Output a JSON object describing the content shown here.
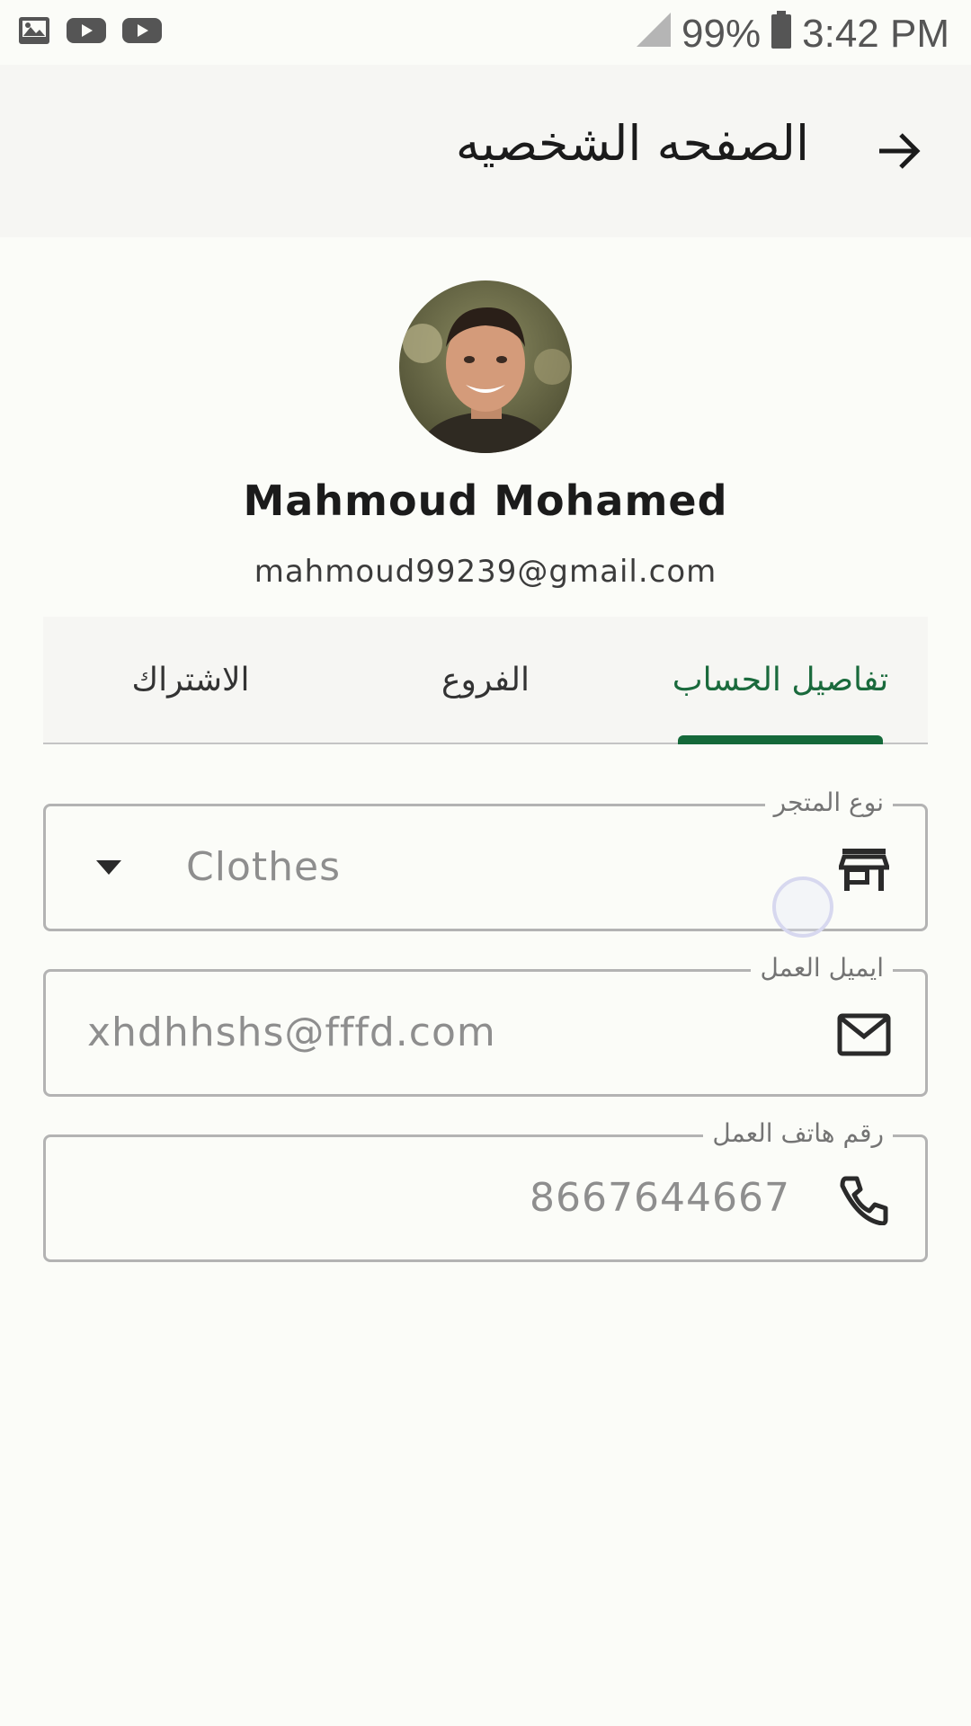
{
  "status_bar": {
    "battery": "99%",
    "time": "3:42 PM",
    "icons": [
      "gallery-icon",
      "youtube-icon",
      "youtube-icon",
      "signal-icon",
      "battery-icon"
    ]
  },
  "app_bar": {
    "title": "الصفحه الشخصيه",
    "back_icon": "arrow-right-icon"
  },
  "profile": {
    "name": "Mahmoud Mohamed",
    "email": "mahmoud99239@gmail.com"
  },
  "tabs": [
    {
      "label": "تفاصيل الحساب",
      "active": true
    },
    {
      "label": "الفروع",
      "active": false
    },
    {
      "label": "الاشتراك",
      "active": false
    }
  ],
  "fields": {
    "store_type": {
      "label": "نوع المتجر",
      "value": "Clothes",
      "icon": "store-icon"
    },
    "work_email": {
      "label": "ايميل العمل",
      "value": "xhdhhshs@fffd.com",
      "icon": "mail-icon"
    },
    "work_phone": {
      "label": "رقم هاتف العمل",
      "value": "8667644667",
      "icon": "phone-icon"
    }
  },
  "colors": {
    "accent": "#15693a",
    "background": "#fbfcf8",
    "appbar": "#f6f6f3",
    "border": "#b3b3b3"
  }
}
